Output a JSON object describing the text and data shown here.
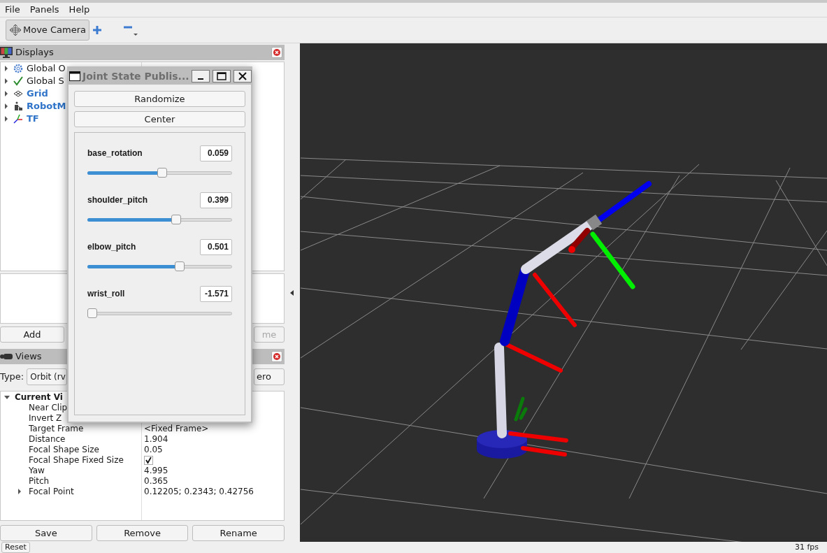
{
  "menu": [
    "File",
    "Panels",
    "Help"
  ],
  "toolbar": {
    "tools": [
      {
        "label": "Move Camera",
        "selected": true
      }
    ]
  },
  "displays": {
    "title": "Displays",
    "items": [
      {
        "label": "Global O",
        "kind": "gear",
        "highlighted": false,
        "expanded": false
      },
      {
        "label": "Global S",
        "kind": "check",
        "highlighted": false,
        "expanded": false
      },
      {
        "label": "Grid",
        "kind": "grid",
        "highlighted": true,
        "expanded": false
      },
      {
        "label": "RobotM",
        "kind": "robot",
        "highlighted": true,
        "expanded": false
      },
      {
        "label": "TF",
        "kind": "axes",
        "highlighted": true,
        "expanded": false
      }
    ],
    "buttons": [
      {
        "label": "Add",
        "disabled": false
      },
      {
        "label": "me",
        "disabled": true
      }
    ]
  },
  "views": {
    "title": "Views",
    "type_label": "Type:",
    "type_value": "Orbit (rv",
    "zero_button": "ero",
    "tree": {
      "label": "Current Vi",
      "expanded": true,
      "children": [
        {
          "name": "Near Clip",
          "kind": "text"
        },
        {
          "name": "Invert Z",
          "kind": "text"
        },
        {
          "name": "Target Frame",
          "kind": "text",
          "value": "<Fixed Frame>"
        },
        {
          "name": "Distance",
          "kind": "text",
          "value": "1.904"
        },
        {
          "name": "Focal Shape Size",
          "kind": "text",
          "value": "0.05"
        },
        {
          "name": "Focal Shape Fixed Size",
          "kind": "checkbox",
          "checked": true
        },
        {
          "name": "Yaw",
          "kind": "text",
          "value": "4.995"
        },
        {
          "name": "Pitch",
          "kind": "text",
          "value": "0.365"
        },
        {
          "name": "Focal Point",
          "kind": "text",
          "value": "0.12205; 0.2343; 0.42756",
          "expanded": false
        }
      ]
    },
    "buttons": [
      "Save",
      "Remove",
      "Rename"
    ]
  },
  "status_bar": {
    "reset": "Reset",
    "fps": "31 fps"
  },
  "dialog": {
    "title": "Joint State Publis...",
    "buttons": [
      "Randomize",
      "Center"
    ],
    "joints": [
      {
        "name": "base_rotation",
        "value": "0.059",
        "level": 0.52
      },
      {
        "name": "shoulder_pitch",
        "value": "0.399",
        "level": 0.62
      },
      {
        "name": "elbow_pitch",
        "value": "0.501",
        "level": 0.65
      },
      {
        "name": "wrist_roll",
        "value": "-1.571",
        "level": 0
      }
    ]
  }
}
